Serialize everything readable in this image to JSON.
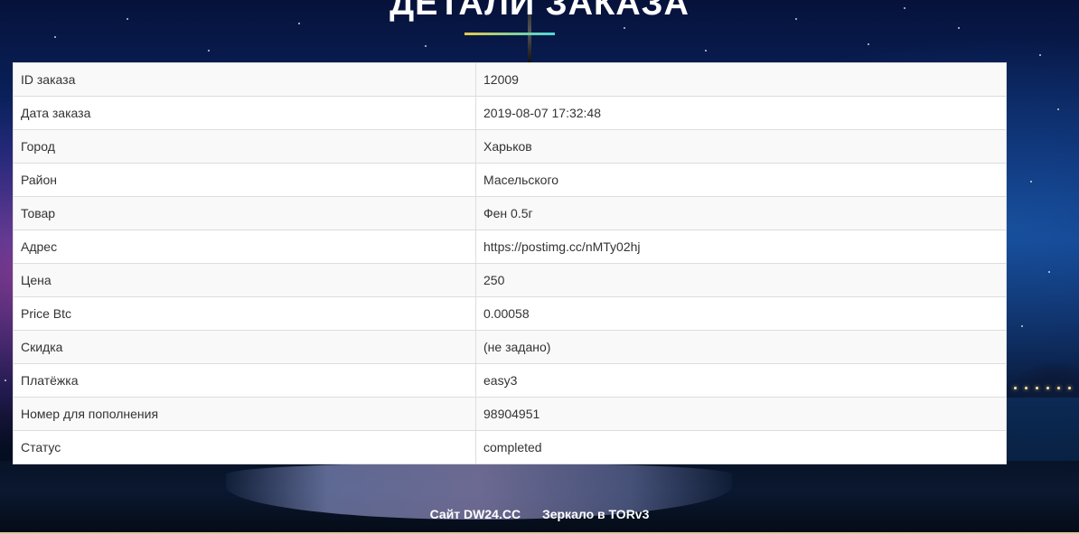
{
  "page": {
    "title": "ДЕТАЛИ ЗАКАЗА"
  },
  "order": {
    "rows": [
      {
        "label": "ID заказа",
        "value": "12009"
      },
      {
        "label": "Дата заказа",
        "value": "2019-08-07 17:32:48"
      },
      {
        "label": "Город",
        "value": "Харьков"
      },
      {
        "label": "Район",
        "value": "Масельского"
      },
      {
        "label": "Товар",
        "value": "Фен 0.5г"
      },
      {
        "label": "Адрес",
        "value": "https://postimg.cc/nMTy02hj"
      },
      {
        "label": "Цена",
        "value": "250"
      },
      {
        "label": "Price Btc",
        "value": "0.00058"
      },
      {
        "label": "Скидка",
        "value": "(не задано)"
      },
      {
        "label": "Платёжка",
        "value": "easy3"
      },
      {
        "label": "Номер для пополнения",
        "value": "98904951"
      },
      {
        "label": "Статус",
        "value": "completed"
      }
    ]
  },
  "footer": {
    "site_link": "Сайт DW24.CC",
    "mirror_link": "Зеркало в TORv3"
  },
  "colors": {
    "accent_gradient_start": "#e8c94a",
    "accent_gradient_end": "#4ed6d6",
    "table_stripe": "#f9f9f9",
    "table_border": "#dddddd"
  }
}
